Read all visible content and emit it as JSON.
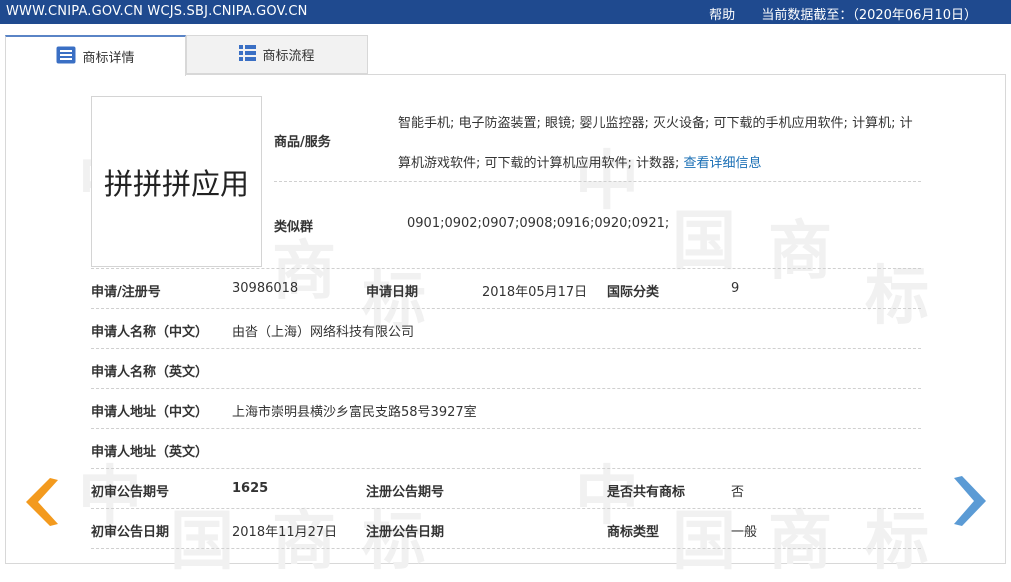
{
  "topbar": {
    "sites": "WWW.CNIPA.GOV.CN WCJS.SBJ.CNIPA.GOV.CN",
    "help": "帮助",
    "data_date": "当前数据截至：（2020年06月10日）"
  },
  "tabs": [
    {
      "label": "商标详情",
      "icon": "list-icon",
      "active": true
    },
    {
      "label": "商标流程",
      "icon": "grid-icon",
      "active": false
    }
  ],
  "watermark": [
    "中",
    "国",
    "商",
    "标"
  ],
  "trademark": {
    "image_text": "拼拼拼应用",
    "goods_label": "商品/服务",
    "goods_text": "智能手机; 电子防盗装置; 眼镜; 婴儿监控器; 灭火设备; 可下载的手机应用软件; 计算机; 计算机游戏软件; 可下载的计算机应用软件; 计数器;",
    "goods_link": "查看详细信息",
    "similar_label": "类似群",
    "similar_value": "0901;0902;0907;0908;0916;0920;0921;"
  },
  "rows": {
    "reg_no_label": "申请/注册号",
    "reg_no": "30986018",
    "apply_date_label": "申请日期",
    "apply_date": "2018年05月17日",
    "intl_class_label": "国际分类",
    "intl_class": "9",
    "applicant_cn_label": "申请人名称（中文）",
    "applicant_cn": "由沓（上海）网络科技有限公司",
    "applicant_en_label": "申请人名称（英文）",
    "applicant_en": "",
    "address_cn_label": "申请人地址（中文）",
    "address_cn": "上海市崇明县横沙乡富民支路58号3927室",
    "address_en_label": "申请人地址（英文）",
    "address_en": "",
    "prelim_no_label": "初审公告期号",
    "prelim_no": "1625",
    "reg_pub_no_label": "注册公告期号",
    "reg_pub_no": "",
    "shared_label": "是否共有商标",
    "shared": "否",
    "prelim_date_label": "初审公告日期",
    "prelim_date": "2018年11月27日",
    "reg_pub_date_label": "注册公告日期",
    "reg_pub_date": "",
    "type_label": "商标类型",
    "type": "一般"
  },
  "nav": {
    "prev_color": "#f39a1e",
    "next_color": "#5b9bd5"
  }
}
